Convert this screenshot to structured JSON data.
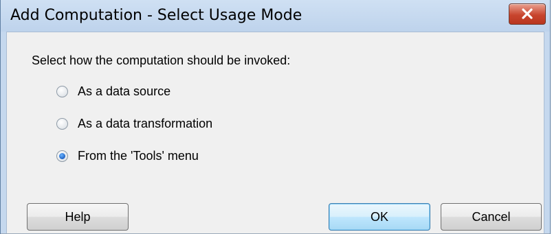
{
  "window": {
    "title": "Add Computation - Select Usage Mode"
  },
  "dialog": {
    "prompt": "Select how the computation should be invoked:",
    "options": [
      {
        "label": "As a data source",
        "checked": false
      },
      {
        "label": "As a data transformation",
        "checked": false
      },
      {
        "label": "From the 'Tools' menu",
        "checked": true
      }
    ]
  },
  "buttons": {
    "help": "Help",
    "ok": "OK",
    "cancel": "Cancel"
  },
  "icons": {
    "close": "close-icon"
  },
  "colors": {
    "title_bar": "#c5d8ee",
    "client_bg": "#f0f0f0",
    "close_button": "#c8452e",
    "radio_selected": "#1a5cbf"
  }
}
